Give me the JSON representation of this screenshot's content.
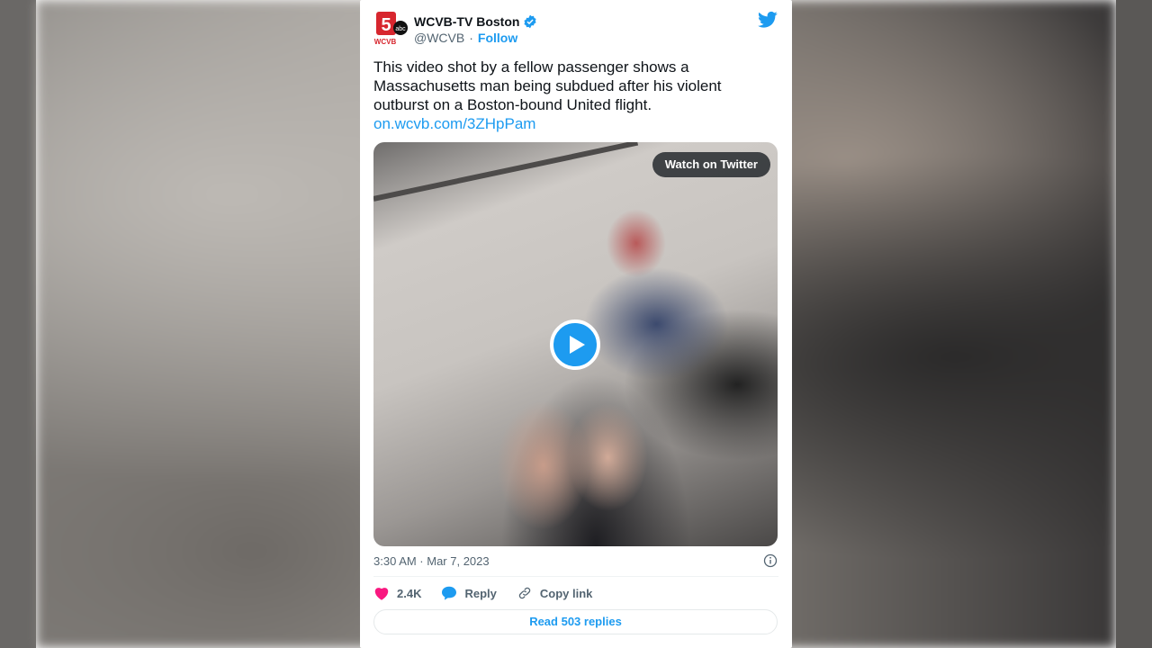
{
  "tweet": {
    "avatar_text": "WCVB",
    "display_name": "WCVB-TV Boston",
    "handle": "@WCVB",
    "separator": "·",
    "follow_label": "Follow",
    "text": "This video shot by a fellow passenger shows a Massachusetts man being subdued after his violent outburst on a Boston-bound United flight.",
    "link": "on.wcvb.com/3ZHpPam",
    "media": {
      "watch_label": "Watch on Twitter"
    },
    "timestamp": "3:30 AM · Mar 7, 2023",
    "actions": {
      "like_count": "2.4K",
      "reply_label": "Reply",
      "copy_label": "Copy link"
    },
    "read_replies_label": "Read 503 replies"
  },
  "colors": {
    "accent": "#1d9bf0",
    "like": "#f91880",
    "text": "#0f1419",
    "muted": "#536471"
  }
}
